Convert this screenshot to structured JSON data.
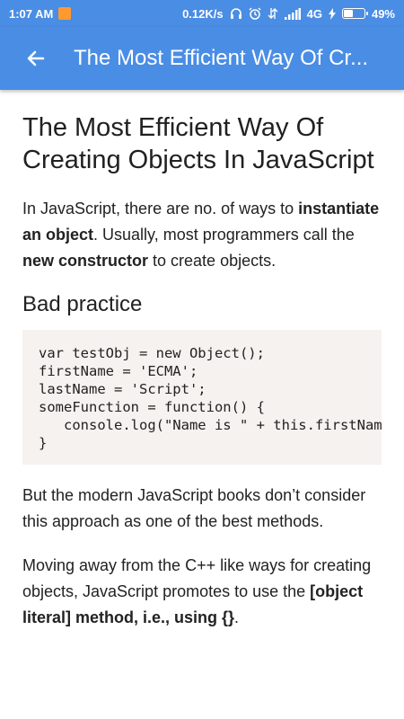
{
  "status_bar": {
    "time": "1:07 AM",
    "network_speed": "0.12K/s",
    "network_type": "4G",
    "battery": "49%",
    "battery_level": 0.49
  },
  "app_bar": {
    "title": "The Most Efficient Way Of Cr..."
  },
  "article": {
    "title": "The Most Efficient Way Of Creating Objects In JavaScript",
    "intro": {
      "t1": "In JavaScript, there are no. of ways to ",
      "b1": "instantiate an object",
      "t2": ". Usually, most programmers call the ",
      "b2": "new constructor",
      "t3": " to create objects."
    },
    "section_heading": "Bad practice",
    "code": "var testObj = new Object();\nfirstName = 'ECMA';\nlastName = 'Script';\nsomeFunction = function() {\n   console.log(\"Name is \" + this.firstName + \" \" + this.lastName);\n}",
    "para2": "But the modern JavaScript books don’t consider this approach as one of the best methods.",
    "para3": {
      "t1": "Moving away from the C++ like ways for creating objects, JavaScript promotes to use the ",
      "b1": "[object literal] method, i.e., using {}",
      "t2": "."
    }
  }
}
